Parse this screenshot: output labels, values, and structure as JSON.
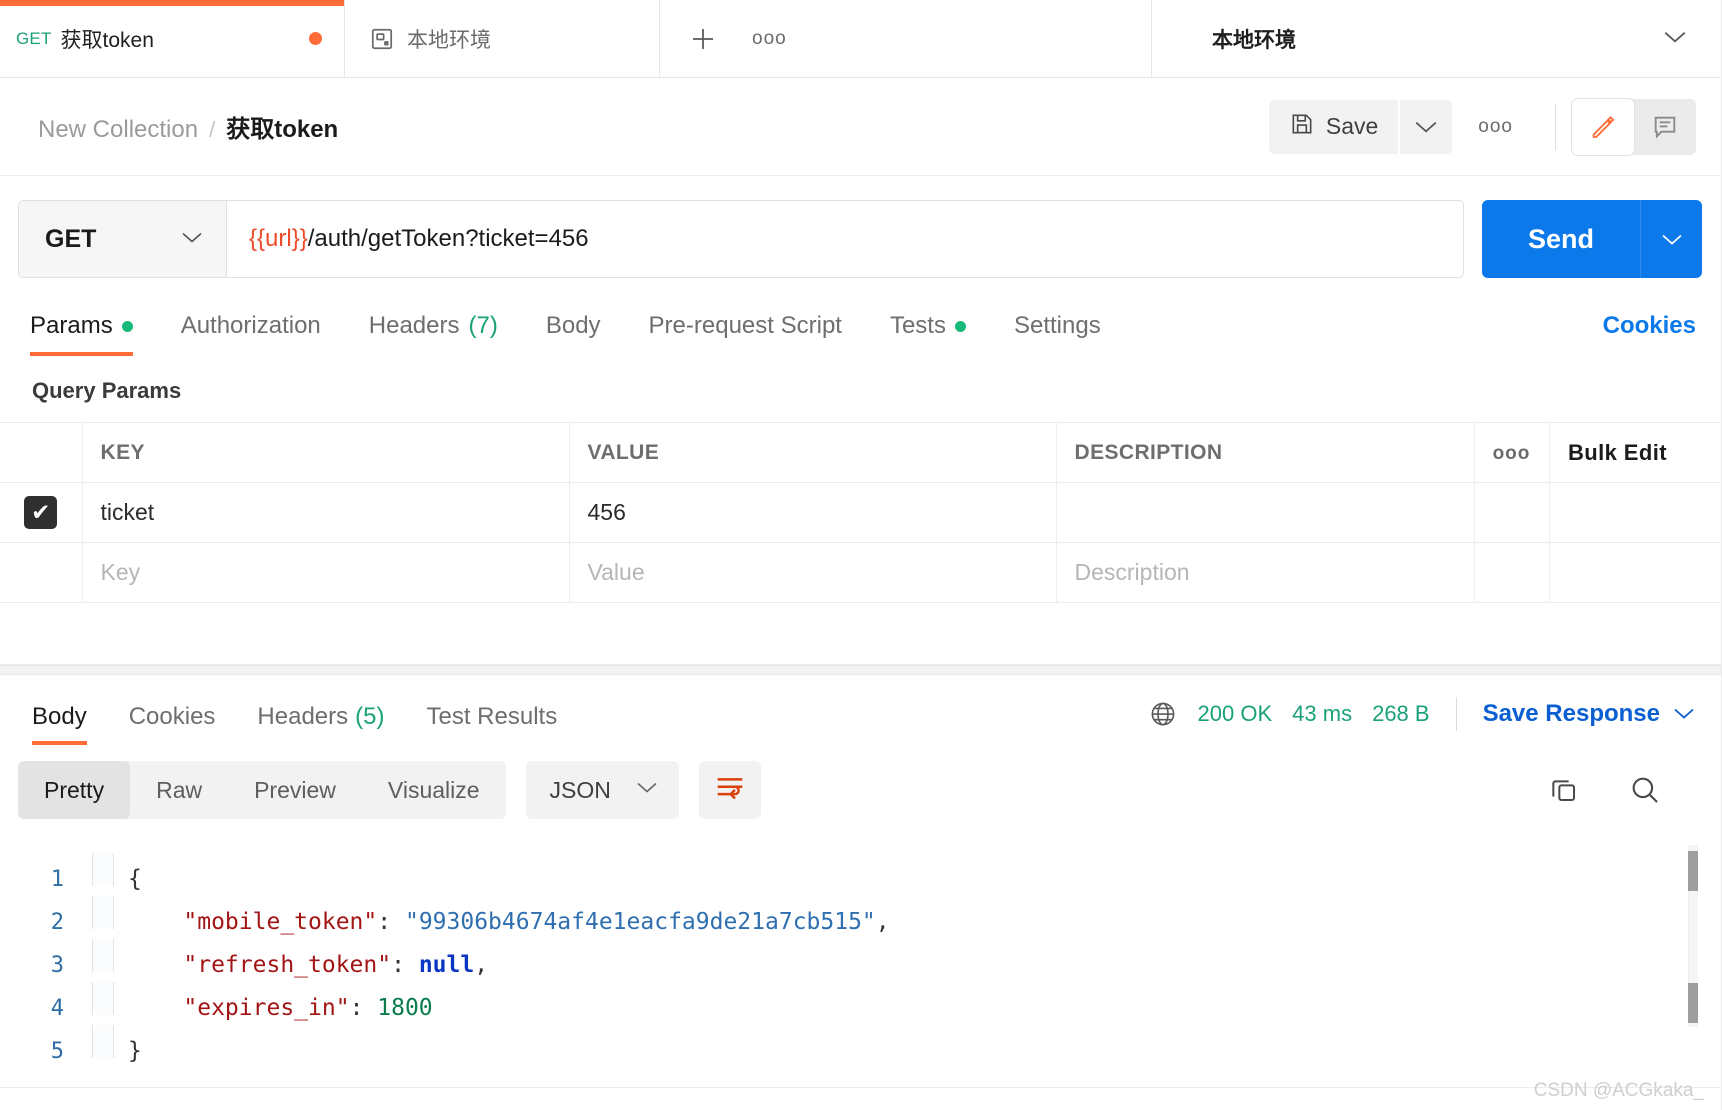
{
  "tabstrip": {
    "request_tab": {
      "method": "GET",
      "title": "获取token",
      "unsaved": "●"
    },
    "env_tab": {
      "label": "本地环境",
      "icon": "environment-icon"
    },
    "new_tab_label": "+",
    "more_label": "ooo",
    "env_selector": {
      "label": "本地环境",
      "caret": "⌄"
    }
  },
  "breadcrumb": {
    "parent": "New Collection",
    "separator": "/",
    "current": "获取token"
  },
  "toolbar": {
    "save_label": "Save",
    "save_caret": "⌄",
    "more_label": "ooo"
  },
  "url_row": {
    "method": "GET",
    "method_caret": "⌄",
    "url_variable": "{{url}}",
    "url_rest": "/auth/getToken?ticket=456",
    "send_label": "Send",
    "send_caret": "⌄"
  },
  "request_tabs": {
    "items": [
      {
        "label": "Params",
        "dot": true,
        "count": ""
      },
      {
        "label": "Authorization",
        "dot": false,
        "count": ""
      },
      {
        "label": "Headers",
        "dot": false,
        "count": "(7)"
      },
      {
        "label": "Body",
        "dot": false,
        "count": ""
      },
      {
        "label": "Pre-request Script",
        "dot": false,
        "count": ""
      },
      {
        "label": "Tests",
        "dot": true,
        "count": ""
      },
      {
        "label": "Settings",
        "dot": false,
        "count": ""
      }
    ],
    "cookies_label": "Cookies"
  },
  "query_params": {
    "section_title": "Query Params",
    "columns": [
      "KEY",
      "VALUE",
      "DESCRIPTION"
    ],
    "col_more": "ooo",
    "bulk_edit_label": "Bulk Edit",
    "rows": [
      {
        "checked": true,
        "check_glyph": "✔",
        "key": "ticket",
        "value": "456",
        "description": ""
      }
    ],
    "placeholder_row": {
      "key": "Key",
      "value": "Value",
      "description": "Description"
    }
  },
  "response": {
    "tabs": [
      {
        "label": "Body",
        "count": ""
      },
      {
        "label": "Cookies",
        "count": ""
      },
      {
        "label": "Headers",
        "count": "(5)"
      },
      {
        "label": "Test Results",
        "count": ""
      }
    ],
    "status": "200 OK",
    "time": "43 ms",
    "size": "268 B",
    "save_response_label": "Save Response",
    "save_response_caret": "⌄",
    "globe_icon": "globe-icon"
  },
  "body_toolbar": {
    "views": [
      "Pretty",
      "Raw",
      "Preview",
      "Visualize"
    ],
    "active_view": "Pretty",
    "format": "JSON",
    "format_caret": "⌄",
    "wrap_icon": "word-wrap-icon",
    "copy_icon": "copy-icon",
    "search_icon": "search-icon"
  },
  "response_body": {
    "language": "json",
    "lines": [
      {
        "n": "1",
        "tokens": [
          {
            "t": "punc",
            "v": "{"
          }
        ]
      },
      {
        "n": "2",
        "tokens": [
          {
            "t": "plain",
            "v": "    "
          },
          {
            "t": "key",
            "v": "\"mobile_token\""
          },
          {
            "t": "punc",
            "v": ": "
          },
          {
            "t": "str",
            "v": "\"99306b4674af4e1eacfa9de21a7cb515\""
          },
          {
            "t": "punc",
            "v": ","
          }
        ]
      },
      {
        "n": "3",
        "tokens": [
          {
            "t": "plain",
            "v": "    "
          },
          {
            "t": "key",
            "v": "\"refresh_token\""
          },
          {
            "t": "punc",
            "v": ": "
          },
          {
            "t": "null",
            "v": "null"
          },
          {
            "t": "punc",
            "v": ","
          }
        ]
      },
      {
        "n": "4",
        "tokens": [
          {
            "t": "plain",
            "v": "    "
          },
          {
            "t": "key",
            "v": "\"expires_in\""
          },
          {
            "t": "punc",
            "v": ": "
          },
          {
            "t": "num",
            "v": "1800"
          }
        ]
      },
      {
        "n": "5",
        "tokens": [
          {
            "t": "punc",
            "v": "}"
          }
        ]
      }
    ]
  },
  "watermark": "CSDN @ACGkaka_",
  "colors": {
    "accent_orange": "#ff6c37",
    "send_blue": "#0b79ea",
    "link_blue": "#0b5fd3",
    "status_green": "#1aa179",
    "method_get_green": "#1aa179"
  }
}
